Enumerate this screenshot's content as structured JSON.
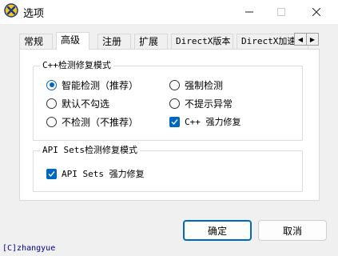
{
  "window": {
    "title": "选项",
    "app_icon": "gear-x-icon",
    "minimize_icon": "minimize-icon",
    "maximize_icon": "maximize-icon",
    "close_icon": "close-icon"
  },
  "tabs": [
    {
      "label": "常规",
      "active": false
    },
    {
      "label": "高级",
      "active": true
    },
    {
      "label": "注册",
      "active": false
    },
    {
      "label": "扩展",
      "active": false
    },
    {
      "label": "DirectX版本",
      "active": false
    },
    {
      "label": "DirectX加速",
      "active": false
    }
  ],
  "tab_scroll": {
    "left": "◀",
    "right": "▶"
  },
  "cpp_group": {
    "label": "C++检测修复模式",
    "options": [
      {
        "label": "智能检测（推荐）",
        "type": "radio",
        "checked": true
      },
      {
        "label": "强制检测",
        "type": "radio",
        "checked": false
      },
      {
        "label": "默认不勾选",
        "type": "radio",
        "checked": false
      },
      {
        "label": "不提示异常",
        "type": "radio",
        "checked": false
      },
      {
        "label": "不检测（不推荐）",
        "type": "radio",
        "checked": false
      },
      {
        "label": "C++ 强力修复",
        "type": "checkbox",
        "checked": true
      }
    ]
  },
  "api_group": {
    "label": "API Sets检测修复模式",
    "options": [
      {
        "label": "API Sets 强力修复",
        "type": "checkbox",
        "checked": true
      }
    ]
  },
  "buttons": {
    "ok": "确定",
    "cancel": "取消"
  },
  "footer": "[C]zhangyue",
  "colors": {
    "accent": "#0067c0",
    "footer_text": "#00008b"
  }
}
